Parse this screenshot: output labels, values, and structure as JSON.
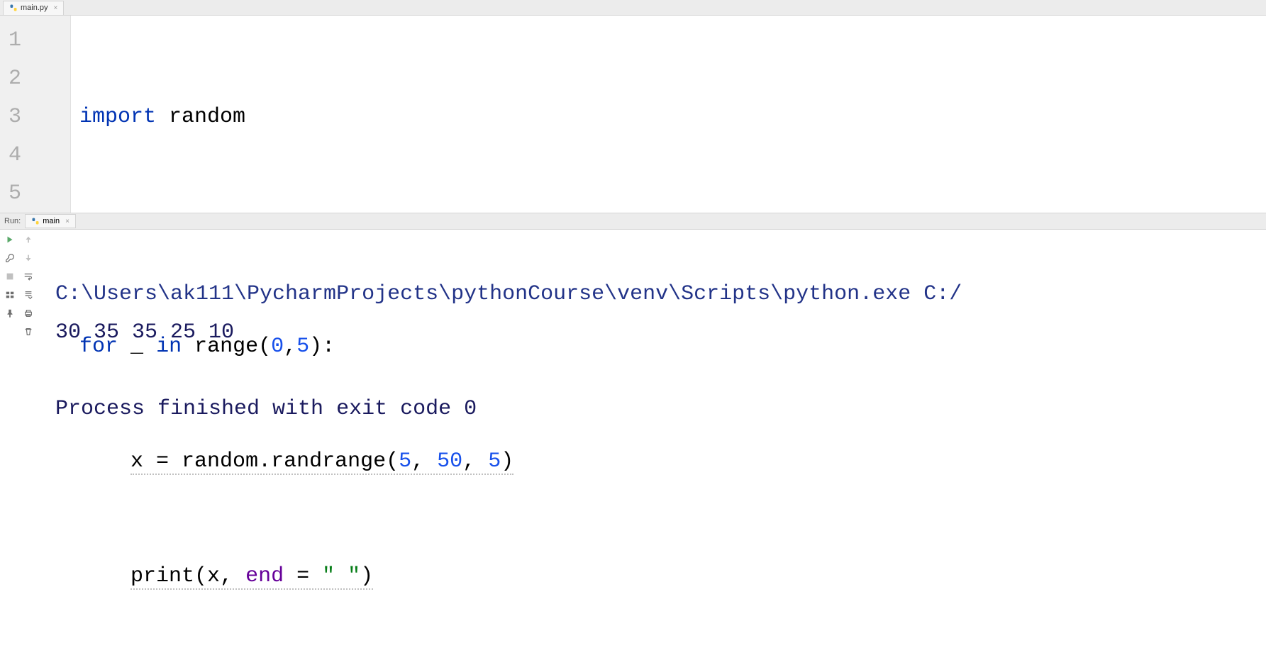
{
  "editor": {
    "tab": {
      "filename": "main.py"
    },
    "lines": {
      "l1": "1",
      "l2": "2",
      "l3": "3",
      "l4": "4",
      "l5": "5"
    },
    "code": {
      "line1": {
        "kw": "import",
        "sp": " ",
        "mod": "random"
      },
      "line3": {
        "kw_for": "for",
        "var": "_",
        "kw_in": "in",
        "fn": "range",
        "open": "(",
        "n0": "0",
        "comma": ",",
        "n5": "5",
        "close": "):"
      },
      "line4": {
        "indent": "    ",
        "var": "x",
        "eq": " = ",
        "obj": "random",
        "dot": ".",
        "fn": "randrange",
        "open": "(",
        "a": "5",
        "c1": ", ",
        "b": "50",
        "c2": ", ",
        "c": "5",
        "close": ")"
      },
      "line5": {
        "indent": "    ",
        "fn": "print",
        "open": "(",
        "var": "x",
        "c1": ", ",
        "param": "end",
        "eq": " = ",
        "str": "\" \"",
        "close": ")"
      }
    }
  },
  "run": {
    "label": "Run:",
    "tab": "main"
  },
  "console": {
    "line1": "C:\\Users\\ak111\\PycharmProjects\\pythonCourse\\venv\\Scripts\\python.exe C:/",
    "line2": "30 35 35 25 10",
    "line3": "Process finished with exit code 0"
  }
}
